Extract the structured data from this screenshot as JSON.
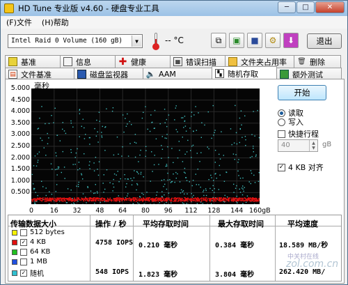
{
  "window": {
    "title": "HD Tune 专业版 v4.60 - 硬盘专业工具",
    "min": "─",
    "max": "□",
    "close": "✕"
  },
  "menu": [
    "(F)文件",
    "(H)帮助"
  ],
  "toolbar": {
    "drive": "Intel   Raid 0 Volume (160 gB)",
    "temperature": "-- °C",
    "icons": [
      "copy-icon",
      "copy-screenshot-icon",
      "save-icon",
      "options-icon",
      "download-icon"
    ],
    "exit_label": "退出"
  },
  "tabs_row1": [
    {
      "label": "基准",
      "icon": "benchmark-icon"
    },
    {
      "label": "信息",
      "icon": "info-icon"
    },
    {
      "label": "健康",
      "icon": "health-icon"
    },
    {
      "label": "错误扫描",
      "icon": "error-scan-icon"
    },
    {
      "label": "文件夹占用率",
      "icon": "folder-icon"
    },
    {
      "label": "删除",
      "icon": "erase-icon"
    }
  ],
  "tabs_row2": [
    {
      "label": "文件基准",
      "icon": "file-benchmark-icon"
    },
    {
      "label": "磁盘监视器",
      "icon": "disk-monitor-icon"
    },
    {
      "label": "AAM",
      "icon": "speaker-icon"
    },
    {
      "label": "随机存取",
      "icon": "random-access-icon",
      "active": true
    },
    {
      "label": "额外测试",
      "icon": "extra-tests-icon"
    }
  ],
  "chart_data": {
    "type": "scatter",
    "ylabel": "毫秒",
    "yticks": [
      "5.000",
      "4.500",
      "4.000",
      "3.500",
      "3.000",
      "2.500",
      "2.000",
      "1.500",
      "1.000",
      "0.500"
    ],
    "xticks": [
      "0",
      "16",
      "32",
      "48",
      "64",
      "80",
      "96",
      "112",
      "128",
      "144",
      "160gB"
    ],
    "xlim": [
      0,
      160
    ],
    "ylim": [
      0,
      5
    ],
    "grid": true,
    "series": [
      {
        "color": "#e01010",
        "description": "red band near baseline",
        "y_range": [
          0.15,
          0.3
        ],
        "x_range": [
          0,
          160
        ]
      },
      {
        "color": "#3fbfbf",
        "description": "cyan scatter across chart",
        "y_range": [
          0.0,
          4.3
        ],
        "x_range": [
          0,
          160
        ]
      }
    ]
  },
  "controls": {
    "start_label": "开始",
    "read_label": "读取",
    "write_label": "写入",
    "short_stroke_label": "快捷行程",
    "short_stroke_value": "40",
    "short_stroke_unit": "gB",
    "align_label": "4 KB 对齐"
  },
  "table": {
    "headers": [
      "传输数据大小",
      "操作 / 秒",
      "平均存取时间",
      "最大存取时间",
      "平均速度"
    ],
    "rows": [
      {
        "size": "512 bytes",
        "color": "#f5f000",
        "checked": false,
        "ops": "",
        "avg": "",
        "max": "",
        "speed": ""
      },
      {
        "size": "4 KB",
        "color": "#e01010",
        "checked": true,
        "ops": "4758 IOPS",
        "avg": "0.210 毫秒",
        "max": "0.384 毫秒",
        "speed": "18.589 MB/秒"
      },
      {
        "size": "64 KB",
        "color": "#20c020",
        "checked": false,
        "ops": "",
        "avg": "",
        "max": "",
        "speed": ""
      },
      {
        "size": "1 MB",
        "color": "#2050e0",
        "checked": false,
        "ops": "",
        "avg": "",
        "max": "",
        "speed": ""
      },
      {
        "size": "随机",
        "color": "#30c0d0",
        "checked": true,
        "ops": "548 IOPS",
        "avg": "1.823 毫秒",
        "max": "3.804 毫秒",
        "speed": "262.420 MB/"
      }
    ]
  },
  "watermark": {
    "text": "zol.com.cn",
    "sub": "中关村在线"
  }
}
